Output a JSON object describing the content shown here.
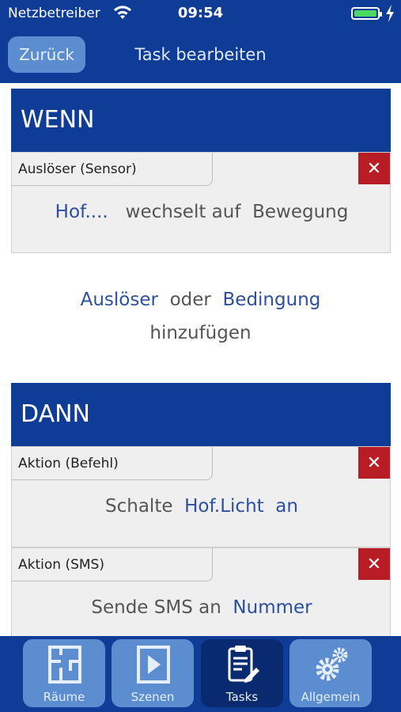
{
  "status": {
    "carrier": "Netzbetreiber",
    "time": "09:54"
  },
  "nav": {
    "back": "Zurück",
    "title": "Task bearbeiten"
  },
  "wenn": {
    "header": "WENN",
    "trigger_label": "Auslöser (Sensor)",
    "delete": "✕",
    "sentence": {
      "object": "Hof....",
      "verb": "wechselt auf",
      "value": "Bewegung"
    }
  },
  "add": {
    "trigger": "Auslöser",
    "or": "oder",
    "condition": "Bedingung",
    "add": "hinzufügen"
  },
  "dann": {
    "header": "DANN",
    "actions": [
      {
        "label": "Aktion (Befehl)",
        "delete": "✕",
        "verb": "Schalte",
        "target": "Hof.Licht",
        "value": "an"
      },
      {
        "label": "Aktion (SMS)",
        "delete": "✕",
        "verb": "Sende SMS an",
        "target": "Nummer"
      }
    ]
  },
  "tabs": [
    {
      "label": "Räume",
      "icon": "rooms-icon"
    },
    {
      "label": "Szenen",
      "icon": "play-icon"
    },
    {
      "label": "Tasks",
      "icon": "clipboard-edit-icon",
      "active": true
    },
    {
      "label": "Allgemein",
      "icon": "gears-icon"
    }
  ],
  "colors": {
    "primary": "#0f3c96",
    "button": "#5b8dd0",
    "delete": "#b81d25",
    "link": "#2d4fa0"
  }
}
